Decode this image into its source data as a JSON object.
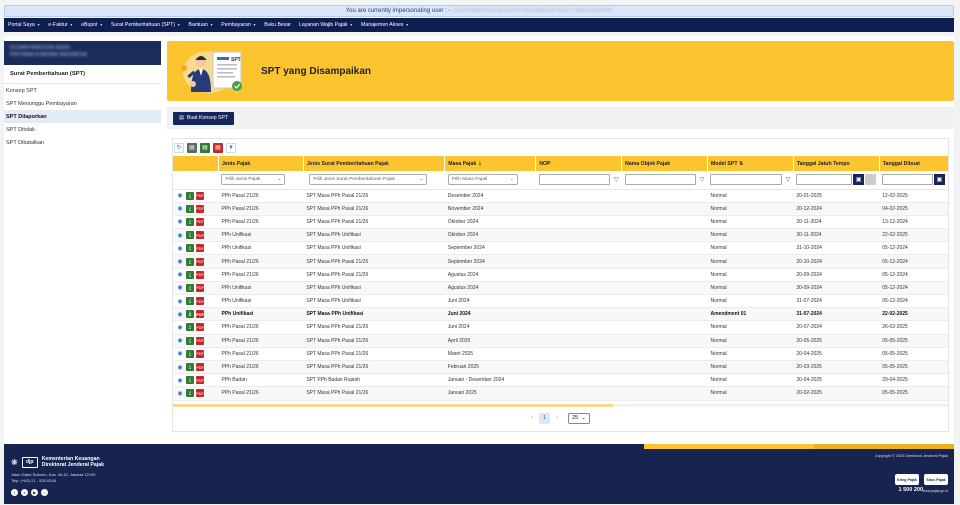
{
  "impersonation": {
    "message": "You are currently impersonating user : -",
    "user": "PERTAMA PERSEROAN INDONESIA SOFT BROADBANK"
  },
  "nav": [
    {
      "label": "Portal Saya",
      "has_menu": true
    },
    {
      "label": "e-Faktur",
      "has_menu": true
    },
    {
      "label": "eBupot",
      "has_menu": true
    },
    {
      "label": "Surat Pemberitahuan (SPT)",
      "has_menu": true
    },
    {
      "label": "Bantuan",
      "has_menu": true
    },
    {
      "label": "Pembayaran",
      "has_menu": true
    },
    {
      "label": "Buku Besar",
      "has_menu": false
    },
    {
      "label": "Layanan Wajib Pajak",
      "has_menu": true
    },
    {
      "label": "Manajemen Akses",
      "has_menu": true
    }
  ],
  "sidebar": {
    "user_line1": "0123456789012345 AGEN",
    "user_line2": "PERTAMA KOMUNIK INDONESIA",
    "section_title": "Surat Pemberitahuan (SPT)",
    "items": [
      {
        "label": "Konsep SPT",
        "active": false
      },
      {
        "label": "SPT Menunggu Pembayaran",
        "active": false
      },
      {
        "label": "SPT Dilaporkan",
        "active": true
      },
      {
        "label": "SPT Ditolak",
        "active": false
      },
      {
        "label": "SPT Dibatalkan",
        "active": false
      }
    ]
  },
  "banner": {
    "title": "SPT yang Disampaikan"
  },
  "buttons": {
    "create_draft": "Buat Konsep SPT"
  },
  "table": {
    "headers": [
      "",
      "Jenis Pajak",
      "Jenis Surat Pemberitahuan Pajak",
      "Masa Pajak",
      "NOP",
      "Nama Objek Pajak",
      "Model SPT",
      "Tanggal Jatuh Tempo",
      "Tanggal Dibuat"
    ],
    "filters": {
      "jenis_pajak": "Pilih Jenis Pajak",
      "jenis_spt": "Pilih Jenis Surat Pemberitahuan Pajak",
      "masa_pajak": "Pilih Masa Pajak"
    },
    "rows": [
      {
        "jenis": "PPh Pasal 21/26",
        "spt": "SPT Masa PPh Pasal 21/26",
        "masa": "Desember 2024",
        "nop": "",
        "nama": "",
        "model": "Normal",
        "jatuh_tempo": "20-01-2025",
        "dibuat": "12-02-2025",
        "bold": false
      },
      {
        "jenis": "PPh Pasal 21/26",
        "spt": "SPT Masa PPh Pasal 21/26",
        "masa": "November 2024",
        "nop": "",
        "nama": "",
        "model": "Normal",
        "jatuh_tempo": "20-12-2024",
        "dibuat": "04-02-2025",
        "bold": false
      },
      {
        "jenis": "PPh Pasal 21/26",
        "spt": "SPT Masa PPh Pasal 21/26",
        "masa": "Oktober 2024",
        "nop": "",
        "nama": "",
        "model": "Normal",
        "jatuh_tempo": "20-11-2024",
        "dibuat": "13-12-2024",
        "bold": false
      },
      {
        "jenis": "PPh Unifikasi",
        "spt": "SPT Masa PPh Unifikasi",
        "masa": "Oktober 2024",
        "nop": "",
        "nama": "",
        "model": "Normal",
        "jatuh_tempo": "30-11-2024",
        "dibuat": "22-02-2025",
        "bold": false
      },
      {
        "jenis": "PPh Unifikasi",
        "spt": "SPT Masa PPh Unifikasi",
        "masa": "September 2024",
        "nop": "",
        "nama": "",
        "model": "Normal",
        "jatuh_tempo": "31-10-2024",
        "dibuat": "05-12-2024",
        "bold": false
      },
      {
        "jenis": "PPh Pasal 21/26",
        "spt": "SPT Masa PPh Pasal 21/26",
        "masa": "September 2024",
        "nop": "",
        "nama": "",
        "model": "Normal",
        "jatuh_tempo": "20-10-2024",
        "dibuat": "05-12-2024",
        "bold": false
      },
      {
        "jenis": "PPh Pasal 21/26",
        "spt": "SPT Masa PPh Pasal 21/26",
        "masa": "Agustus 2024",
        "nop": "",
        "nama": "",
        "model": "Normal",
        "jatuh_tempo": "20-09-2024",
        "dibuat": "05-12-2024",
        "bold": false
      },
      {
        "jenis": "PPh Unifikasi",
        "spt": "SPT Masa PPh Unifikasi",
        "masa": "Agustus 2024",
        "nop": "",
        "nama": "",
        "model": "Normal",
        "jatuh_tempo": "30-09-2024",
        "dibuat": "05-12-2024",
        "bold": false
      },
      {
        "jenis": "PPh Unifikasi",
        "spt": "SPT Masa PPh Unifikasi",
        "masa": "Juni 2024",
        "nop": "",
        "nama": "",
        "model": "Normal",
        "jatuh_tempo": "31-07-2024",
        "dibuat": "05-12-2024",
        "bold": false
      },
      {
        "jenis": "PPh Unifikasi",
        "spt": "SPT Masa PPh Unifikasi",
        "masa": "Juni 2024",
        "nop": "",
        "nama": "",
        "model": "Amendment 01",
        "jatuh_tempo": "31-07-2024",
        "dibuat": "22-02-2025",
        "bold": true
      },
      {
        "jenis": "PPh Pasal 21/26",
        "spt": "SPT Masa PPh Pasal 21/26",
        "masa": "Juni 2024",
        "nop": "",
        "nama": "",
        "model": "Normal",
        "jatuh_tempo": "20-07-2024",
        "dibuat": "26-02-2025",
        "bold": false
      },
      {
        "jenis": "PPh Pasal 21/26",
        "spt": "SPT Masa PPh Pasal 21/26",
        "masa": "April 2025",
        "nop": "",
        "nama": "",
        "model": "Normal",
        "jatuh_tempo": "20-05-2025",
        "dibuat": "05-05-2025",
        "bold": false
      },
      {
        "jenis": "PPh Pasal 21/26",
        "spt": "SPT Masa PPh Pasal 21/26",
        "masa": "Maret 2025",
        "nop": "",
        "nama": "",
        "model": "Normal",
        "jatuh_tempo": "20-04-2025",
        "dibuat": "05-05-2025",
        "bold": false
      },
      {
        "jenis": "PPh Pasal 21/26",
        "spt": "SPT Masa PPh Pasal 21/26",
        "masa": "Februari 2025",
        "nop": "",
        "nama": "",
        "model": "Normal",
        "jatuh_tempo": "20-03-2025",
        "dibuat": "05-05-2025",
        "bold": false
      },
      {
        "jenis": "PPh Badan",
        "spt": "SPT PPh Badan Rupiah",
        "masa": "Januari - Desember 2024",
        "nop": "",
        "nama": "",
        "model": "Normal",
        "jatuh_tempo": "30-04-2025",
        "dibuat": "29-04-2025",
        "bold": false
      },
      {
        "jenis": "PPh Pasal 21/26",
        "spt": "SPT Masa PPh Pasal 21/26",
        "masa": "Januari 2025",
        "nop": "",
        "nama": "",
        "model": "Normal",
        "jatuh_tempo": "20-02-2025",
        "dibuat": "05-05-2025",
        "bold": false
      }
    ]
  },
  "pagination": {
    "current_page": "1",
    "page_size": "25"
  },
  "footer": {
    "logo_text": "djp",
    "org_line1": "Kementerian Keuangan",
    "org_line2": "Direktorat Jenderal Pajak",
    "address": "Jalan Gatot Subroto, Kav. 40-42, Jakarta 12190",
    "phone": "Telp: (+62) 21 - 525 0208",
    "copyright": "Copyright © 2025 Direktorat Jenderal Pajak",
    "badge1": "Kring Pajak",
    "badge2": "Situs Pajak",
    "call_number": "1 500 200",
    "url": "www.pajak.go.id"
  },
  "colors": {
    "navy": "#0f1e50",
    "accent_yellow": "#fcc52f",
    "download_green": "#2e7d32",
    "pdf_red": "#c62828"
  }
}
